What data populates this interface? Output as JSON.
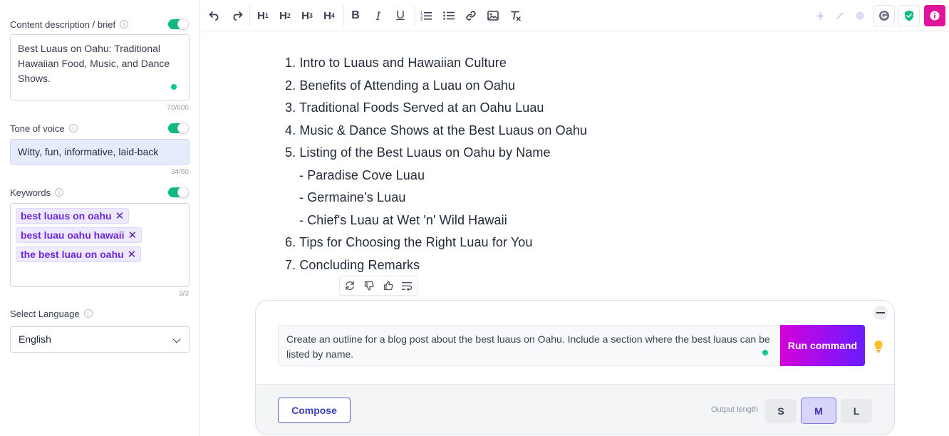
{
  "sidebar": {
    "brief": {
      "label": "Content description / brief",
      "value": "Best Luaus on Oahu: Traditional Hawaiian Food, Music, and Dance Shows.",
      "counter": "70/600",
      "enabled": true
    },
    "tone": {
      "label": "Tone of voice",
      "value": "Witty, fun, informative, laid-back",
      "counter": "34/60",
      "enabled": true
    },
    "keywords": {
      "label": "Keywords",
      "items": [
        "best luaus on oahu",
        "best luau oahu hawaii",
        "the best luau on oahu"
      ],
      "counter": "3/3",
      "enabled": true
    },
    "language": {
      "label": "Select Language",
      "value": "English"
    }
  },
  "toolbar": {
    "icons": [
      "undo-icon",
      "redo-icon",
      "heading-1-icon",
      "heading-2-icon",
      "heading-3-icon",
      "heading-4-icon",
      "bold-icon",
      "italic-icon",
      "underline-icon",
      "ordered-list-icon",
      "bullet-list-icon",
      "link-icon",
      "image-icon",
      "clear-format-icon",
      "sparkle-icon",
      "pen-icon",
      "emoji-icon",
      "grammarly-icon",
      "shield-check-icon",
      "info-icon"
    ],
    "heading_labels": [
      "H",
      "H",
      "H",
      "H"
    ],
    "heading_levels": [
      "1",
      "2",
      "3",
      "4"
    ],
    "bold": "B",
    "italic": "I",
    "underline": "U"
  },
  "document": {
    "lines": [
      "1. Intro to Luaus and Hawaiian Culture",
      "2. Benefits of Attending a Luau on Oahu",
      "3. Traditional Foods Served at an Oahu Luau",
      "4. Music & Dance Shows at the Best Luaus on Oahu",
      "5. Listing of the Best Luaus on Oahu by Name",
      "- Paradise Cove Luau",
      "- Germaine’s Luau",
      "- Chief's Luau at Wet 'n' Wild Hawaii",
      "6. Tips for Choosing the Right Luau for You",
      "7. Concluding Remarks"
    ]
  },
  "mini_toolbar": {
    "icons": [
      "regenerate-icon",
      "thumbs-down-icon",
      "thumbs-up-icon",
      "wrap-text-icon"
    ]
  },
  "command": {
    "text": "Create an outline for a blog post about the best luaus on Oahu. Include a section where the best luaus can be listed by name.",
    "run_label": "Run command",
    "compose_label": "Compose",
    "output_length_label": "Output length",
    "sizes": [
      "S",
      "M",
      "L"
    ],
    "selected_size": "M"
  },
  "colors": {
    "accent_green": "#10b981",
    "chip_bg": "#ede9fe",
    "chip_text": "#6d28d9",
    "run_gradient_start": "#d400d8",
    "run_gradient_end": "#6a1cff",
    "compose_border": "#5b62c9",
    "brand_pink": "#e0149a"
  }
}
